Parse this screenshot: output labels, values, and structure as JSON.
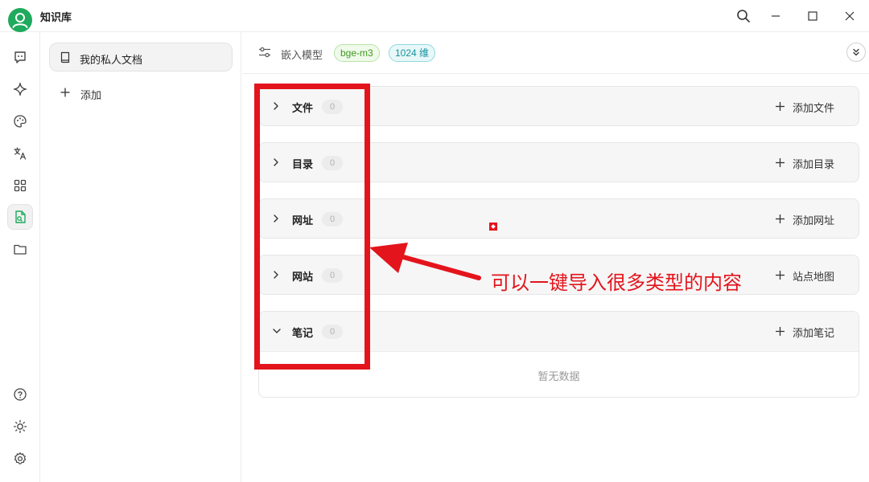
{
  "app": {
    "title": "知识库"
  },
  "window_controls": [
    "search-icon",
    "minimize-icon",
    "maximize-icon",
    "close-icon"
  ],
  "rail": {
    "icons": [
      "chat-icon",
      "sparkle-icon",
      "palette-icon",
      "translate-icon",
      "apps-icon",
      "knowledge-icon",
      "folder-icon",
      "help-icon",
      "sun-icon",
      "settings-icon"
    ],
    "active": "knowledge-icon"
  },
  "kb_list": {
    "items": [
      {
        "label": "我的私人文档"
      }
    ],
    "add_label": "添加"
  },
  "toolbar": {
    "embed_label": "嵌入模型",
    "model_tag": "bge-m3",
    "dim_tag": "1024 维"
  },
  "sections": [
    {
      "title": "文件",
      "count": "0",
      "action": "添加文件",
      "expanded": false
    },
    {
      "title": "目录",
      "count": "0",
      "action": "添加目录",
      "expanded": false
    },
    {
      "title": "网址",
      "count": "0",
      "action": "添加网址",
      "expanded": false
    },
    {
      "title": "网站",
      "count": "0",
      "action": "站点地图",
      "expanded": false
    },
    {
      "title": "笔记",
      "count": "0",
      "action": "添加笔记",
      "expanded": true
    }
  ],
  "notes_empty": "暂无数据",
  "annotation": {
    "text": "可以一键导入很多类型的内容",
    "color": "#e3141c"
  },
  "colors": {
    "accent_green": "#1faa5d",
    "tag_green": "#3e9a22",
    "tag_teal": "#16939d"
  }
}
